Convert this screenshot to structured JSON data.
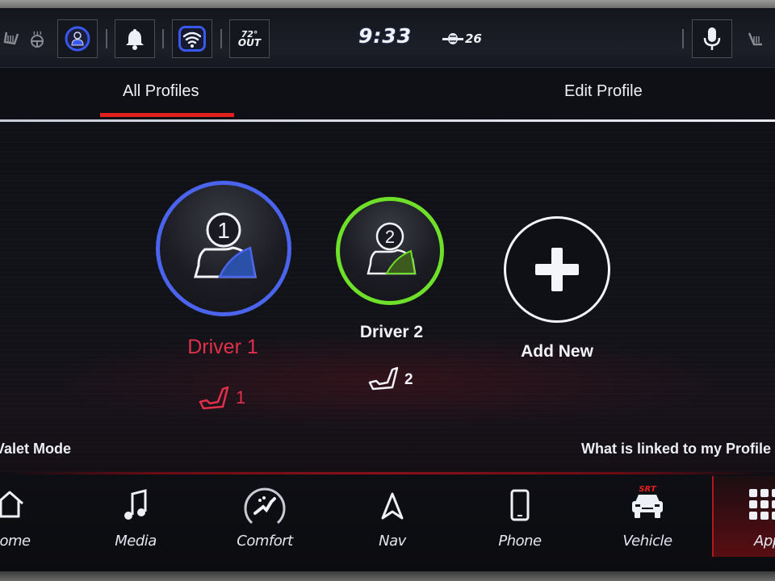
{
  "status_bar": {
    "left_icons": [
      "heated-seat-icon",
      "heated-steering-icon"
    ],
    "buttons": [
      {
        "name": "driver-profile-button",
        "icon": "driver-profile-icon"
      },
      {
        "name": "notifications-button",
        "icon": "bell-icon"
      },
      {
        "name": "wifi-button",
        "icon": "wifi-icon"
      },
      {
        "name": "outside-temp-button",
        "icon": "temperature"
      }
    ],
    "temperature": "72°",
    "temperature_sub": "OUT",
    "time": "9:33",
    "satellite_count": "26",
    "right_buttons": [
      {
        "name": "voice-button",
        "icon": "microphone-icon"
      }
    ],
    "right_icons": [
      "passenger-heated-seat-icon"
    ]
  },
  "tabs": [
    {
      "label": "All Profiles",
      "active": true
    },
    {
      "label": "Edit Profile",
      "active": false
    }
  ],
  "profiles": [
    {
      "label": "Driver 1",
      "number": "1",
      "seat": "1",
      "color": "#4a64ee",
      "selected": true
    },
    {
      "label": "Driver 2",
      "number": "2",
      "seat": "2",
      "color": "#6ee02a",
      "selected": false
    }
  ],
  "add_new": {
    "label": "Add New"
  },
  "links": {
    "valet_mode": "Valet Mode",
    "linked": "What is linked to my Profile"
  },
  "nav": [
    {
      "label": "Home",
      "icon": "home-icon",
      "active": false
    },
    {
      "label": "Media",
      "icon": "music-note-icon",
      "active": false
    },
    {
      "label": "Comfort",
      "icon": "comfort-seat-icon",
      "active": false
    },
    {
      "label": "Nav",
      "icon": "navigation-arrow-icon",
      "active": false
    },
    {
      "label": "Phone",
      "icon": "phone-icon",
      "active": false
    },
    {
      "label": "Vehicle",
      "icon": "vehicle-srt-icon",
      "badge": "SRT",
      "active": false
    },
    {
      "label": "Apps",
      "icon": "apps-grid-icon",
      "active": true
    }
  ],
  "colors": {
    "accent_red": "#e0201c",
    "driver1_ring": "#4a64ee",
    "driver2_ring": "#6ee02a",
    "selected_label": "#e0304a"
  }
}
